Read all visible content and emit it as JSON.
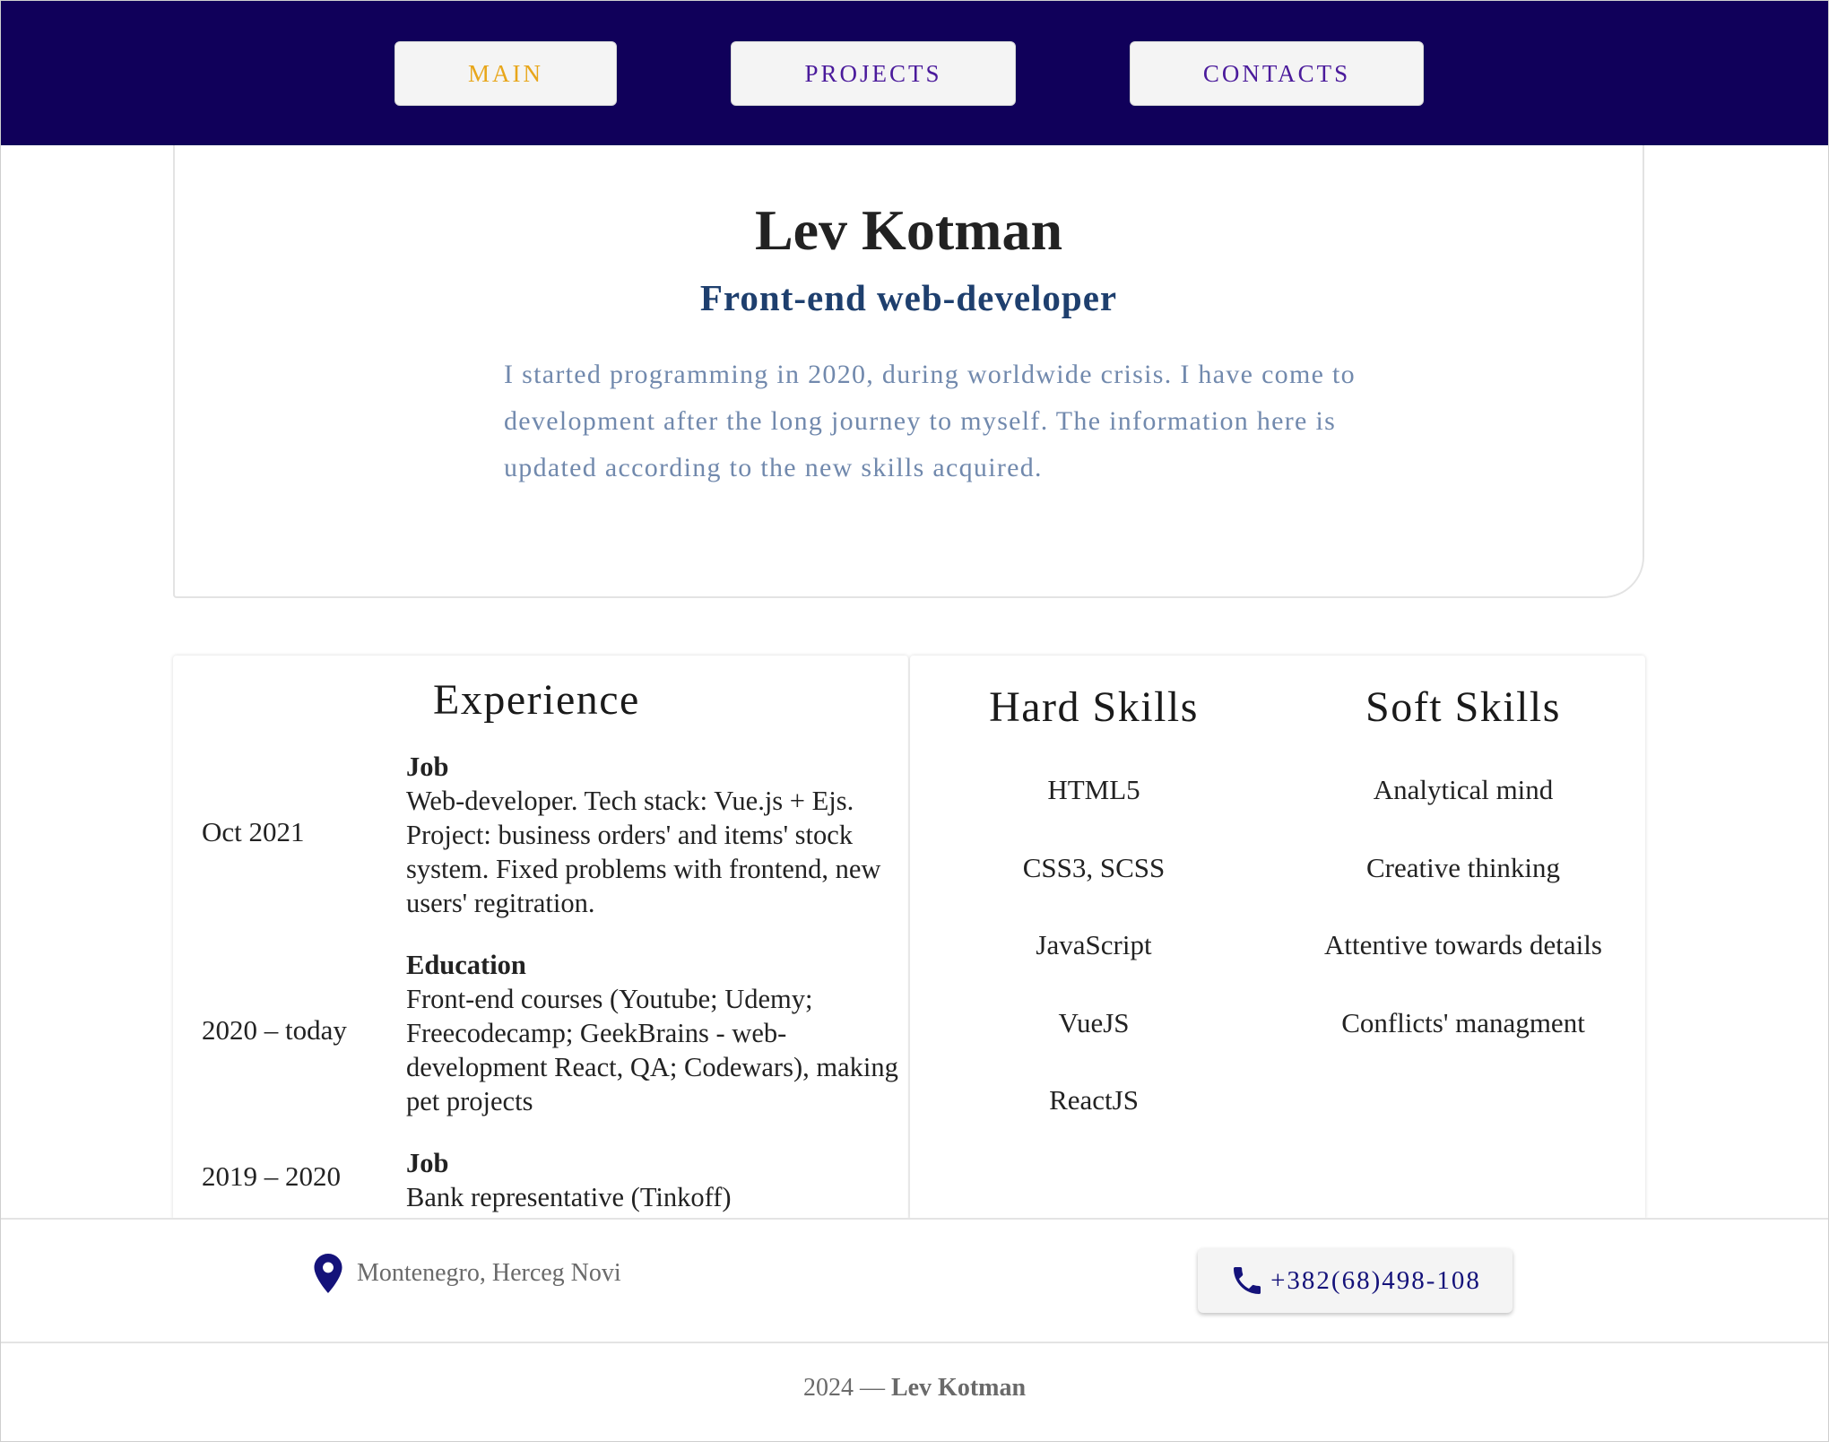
{
  "nav": {
    "main": "MAIN",
    "projects": "PROJECTS",
    "contacts": "CONTACTS"
  },
  "hero": {
    "name": "Lev Kotman",
    "role": "Front-end web-developer",
    "bio": "I started programming in 2020, during worldwide crisis. I have come to development after the long journey to myself. The information here is updated according to the new skills acquired."
  },
  "experience": {
    "title": "Experience",
    "entries": [
      {
        "date": "Oct 2021",
        "kind": "Job",
        "description": "Web-developer. Tech stack: Vue.js + Ejs. Project: business orders' and items' stock system. Fixed problems with frontend, new users' regitration."
      },
      {
        "date": "2020 – today",
        "kind": "Education",
        "description": "Front-end courses (Youtube; Udemy; Freecodecamp; GeekBrains - web-development React, QA; Codewars), making pet projects"
      },
      {
        "date": "2019 – 2020",
        "kind": "Job",
        "description": "Bank representative (Tinkoff)"
      }
    ]
  },
  "skills": {
    "hard_title": "Hard Skills",
    "hard": [
      "HTML5",
      "CSS3, SCSS",
      "JavaScript",
      "VueJS",
      "ReactJS"
    ],
    "soft_title": "Soft Skills",
    "soft": [
      "Analytical mind",
      "Creative thinking",
      "Attentive towards details",
      "Conflicts' managment"
    ]
  },
  "contact": {
    "location_icon": "map-pin-icon",
    "location": "Montenegro, Herceg Novi",
    "phone_icon": "phone-icon",
    "phone": "+382(68)498-108"
  },
  "footer": {
    "year": "2024",
    "separator": "—",
    "owner": "Lev Kotman"
  },
  "colors": {
    "nav_background": "#10005a",
    "nav_active": "#e8a61a",
    "nav_link": "#4a1a9b",
    "role": "#1e3f6e",
    "bio": "#7189ad",
    "accent_icon": "#14127a"
  }
}
